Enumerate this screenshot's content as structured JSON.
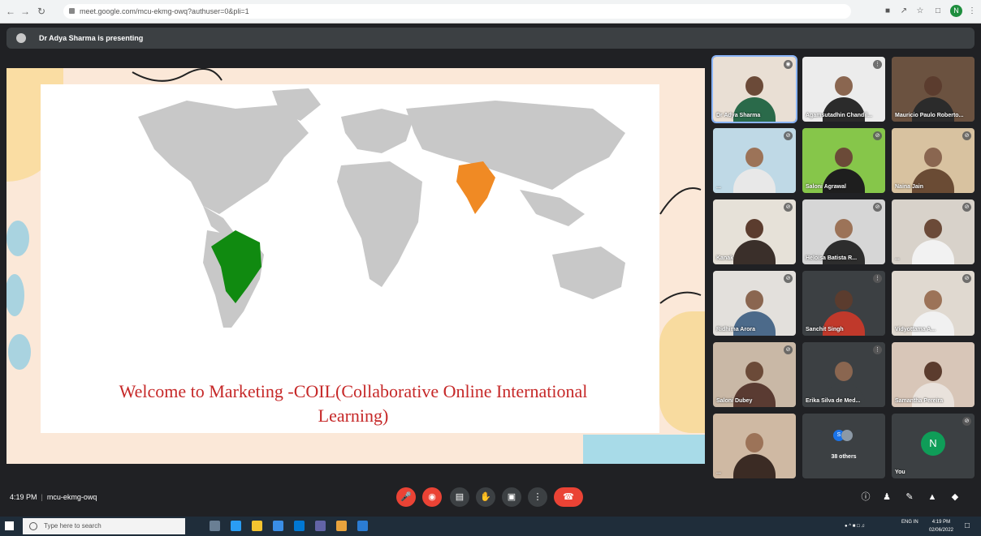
{
  "browser": {
    "url": "meet.google.com/mcu-ekmg-owq?authuser=0&pli=1",
    "nav_icons": [
      "back-icon",
      "forward-icon",
      "reload-icon"
    ],
    "extension_icons": [
      "extension-icon",
      "share-icon",
      "star-icon",
      "tab-icon"
    ],
    "profile_initial": "N"
  },
  "presenting": {
    "text": "Dr Adya Sharma is presenting"
  },
  "slide": {
    "title": "Welcome to Marketing -COIL(Collaborative Online International Learning)",
    "title_color": "#c62828",
    "highlight_colors": {
      "india": "#f08a24",
      "brazil": "#108a10",
      "land": "#c8c8c8"
    }
  },
  "participants": [
    {
      "name": "Dr Adya Sharma",
      "bg": "#e9dfd4",
      "body": "#2a6a4a",
      "active": true,
      "mic": "pin-icon"
    },
    {
      "name": "Agamsutadhin Chandil...",
      "bg": "#ececec",
      "body": "#2b2b2b",
      "active": false,
      "mic": "more-icon"
    },
    {
      "name": "Mauricio Paulo Roberto...",
      "bg": "#6b5240",
      "body": "#2b2b2b",
      "active": false,
      "mic": ""
    },
    {
      "name": "...",
      "bg": "#bfd9e6",
      "body": "#e8e8e8",
      "active": false,
      "mic": "mic-off-icon"
    },
    {
      "name": "Saloni Agrawal",
      "bg": "#86c64a",
      "body": "#1e1e1e",
      "active": false,
      "mic": "mic-off-icon"
    },
    {
      "name": "Naina Jain",
      "bg": "#d8c2a0",
      "body": "#6a4b34",
      "active": false,
      "mic": "mic-off-icon"
    },
    {
      "name": "Kanak",
      "bg": "#e6e1d8",
      "body": "#3a2f2a",
      "active": false,
      "mic": "mic-off-icon"
    },
    {
      "name": "Heloisa Batista R...",
      "bg": "#d6d6d6",
      "body": "#2d2d2d",
      "active": false,
      "mic": "mic-off-icon"
    },
    {
      "name": "...",
      "bg": "#d8d2ca",
      "body": "#f2f2f2",
      "active": false,
      "mic": "mic-off-icon"
    },
    {
      "name": "Ridhima Arora",
      "bg": "#e3e0dc",
      "body": "#4c6a8a",
      "active": false,
      "mic": "mic-off-icon"
    },
    {
      "name": "Sanchit Singh",
      "bg": "#3c4043",
      "body": "#c0392b",
      "active": false,
      "mic": "more-icon"
    },
    {
      "name": "Vidyottama A...",
      "bg": "#e0d9d0",
      "body": "#f1f1f1",
      "active": false,
      "mic": "mic-off-icon"
    },
    {
      "name": "Saloni Dubey",
      "bg": "#c9b8a6",
      "body": "#5a3b32",
      "active": false,
      "mic": "mic-off-icon"
    },
    {
      "name": "Erika Silva de Med...",
      "bg": "#3c4043",
      "body": "#3c4043",
      "active": false,
      "mic": "more-icon"
    },
    {
      "name": "Samantha Pereira",
      "bg": "#d8c6b8",
      "body": "#e9e2dc",
      "active": false,
      "mic": ""
    },
    {
      "name": "...",
      "bg": "#cfb9a3",
      "body": "#3b2b24",
      "active": false,
      "mic": ""
    }
  ],
  "others": {
    "label": "38 others",
    "initial": "S"
  },
  "you": {
    "label": "You",
    "initial": "N"
  },
  "meetbar": {
    "time": "4:19 PM",
    "code": "mcu-ekmg-owq",
    "controls": [
      "mic-off-icon",
      "camera-off-icon",
      "captions-icon",
      "raise-hand-icon",
      "present-icon",
      "more-options-icon",
      "end-call-icon"
    ],
    "right_controls": [
      "info-icon",
      "people-icon",
      "chat-icon",
      "activities-icon",
      "host-controls-icon"
    ]
  },
  "taskbar": {
    "search_placeholder": "Type here to search",
    "clock_time": "4:19 PM",
    "clock_date": "02/06/2022",
    "lang": "ENG IN"
  }
}
